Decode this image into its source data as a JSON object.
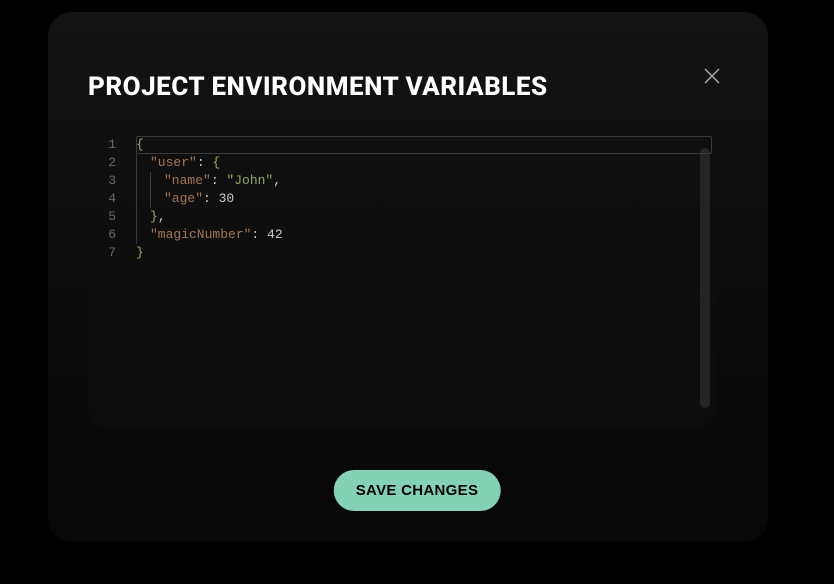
{
  "modal": {
    "title": "PROJECT ENVIRONMENT VARIABLES",
    "save_label": "SAVE CHANGES"
  },
  "code": [
    {
      "num": "1",
      "indent": 0,
      "tokens": [
        {
          "t": "{",
          "c": "tok-brace"
        }
      ]
    },
    {
      "num": "2",
      "indent": 1,
      "tokens": [
        {
          "t": "\"user\"",
          "c": "tok-key"
        },
        {
          "t": ": ",
          "c": "tok-punct"
        },
        {
          "t": "{",
          "c": "tok-brace"
        }
      ]
    },
    {
      "num": "3",
      "indent": 2,
      "tokens": [
        {
          "t": "\"name\"",
          "c": "tok-key"
        },
        {
          "t": ": ",
          "c": "tok-punct"
        },
        {
          "t": "\"John\"",
          "c": "tok-string"
        },
        {
          "t": ",",
          "c": "tok-punct"
        }
      ]
    },
    {
      "num": "4",
      "indent": 2,
      "tokens": [
        {
          "t": "\"age\"",
          "c": "tok-key"
        },
        {
          "t": ": ",
          "c": "tok-punct"
        },
        {
          "t": "30",
          "c": "tok-num"
        }
      ]
    },
    {
      "num": "5",
      "indent": 1,
      "tokens": [
        {
          "t": "}",
          "c": "tok-brace"
        },
        {
          "t": ",",
          "c": "tok-punct"
        }
      ]
    },
    {
      "num": "6",
      "indent": 1,
      "tokens": [
        {
          "t": "\"magicNumber\"",
          "c": "tok-key"
        },
        {
          "t": ": ",
          "c": "tok-punct"
        },
        {
          "t": "42",
          "c": "tok-num"
        }
      ]
    },
    {
      "num": "7",
      "indent": 0,
      "tokens": [
        {
          "t": "}",
          "c": "tok-brace"
        }
      ]
    }
  ]
}
